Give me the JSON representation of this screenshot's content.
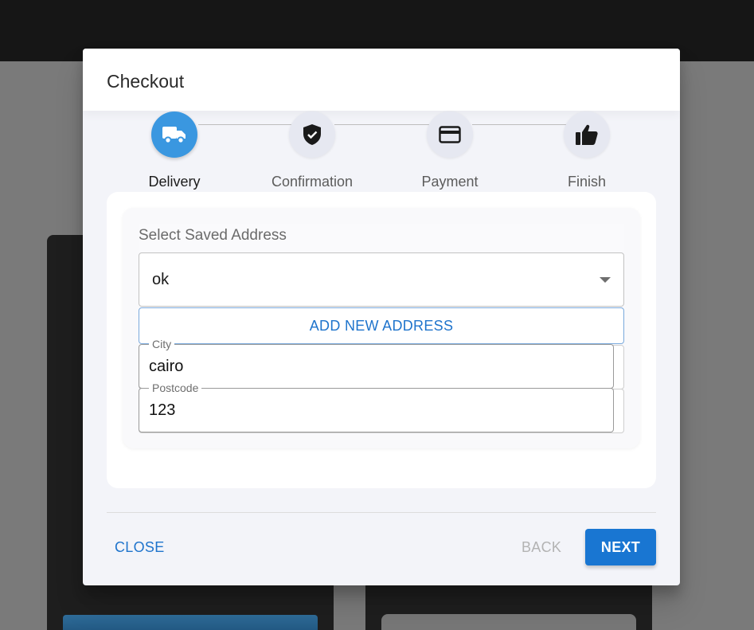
{
  "dialog": {
    "title": "Checkout"
  },
  "stepper": {
    "steps": [
      {
        "label": "Delivery",
        "icon": "truck-icon",
        "active": true
      },
      {
        "label": "Confirmation",
        "icon": "shield-check-icon",
        "active": false
      },
      {
        "label": "Payment",
        "icon": "credit-card-icon",
        "active": false
      },
      {
        "label": "Finish",
        "icon": "thumbs-up-icon",
        "active": false
      }
    ]
  },
  "address": {
    "select_label": "Select Saved Address",
    "selected_value": "ok",
    "add_new_label": "ADD NEW ADDRESS",
    "city": {
      "label": "City",
      "value": "cairo"
    },
    "postcode": {
      "label": "Postcode",
      "value": "123"
    }
  },
  "footer": {
    "close_label": "CLOSE",
    "back_label": "BACK",
    "next_label": "NEXT"
  },
  "colors": {
    "accent": "#1976d2",
    "active_step": "#3a97e0"
  }
}
